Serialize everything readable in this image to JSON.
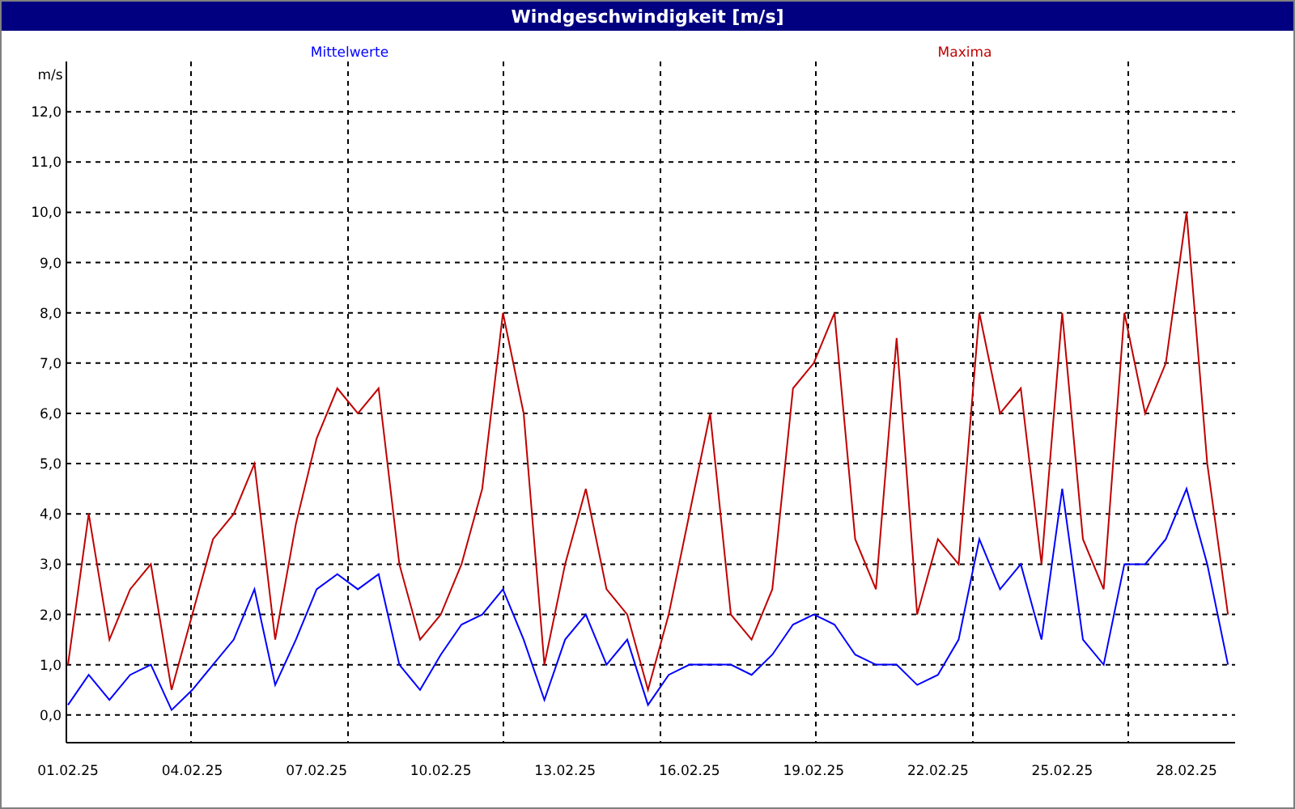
{
  "window": {
    "title": "Windgeschwindigkeit [m/s]"
  },
  "chart": {
    "chart_data": {
      "type": "line",
      "ylabel": "m/s",
      "categories": [
        "01.02.25",
        null,
        null,
        null,
        null,
        null,
        "04.02.25",
        null,
        null,
        null,
        null,
        null,
        "07.02.25",
        null,
        null,
        null,
        null,
        null,
        "10.02.25",
        null,
        null,
        null,
        null,
        null,
        "13.02.25",
        null,
        null,
        null,
        null,
        null,
        "16.02.25",
        null,
        null,
        null,
        null,
        null,
        "19.02.25",
        null,
        null,
        null,
        null,
        null,
        "22.02.25",
        null,
        null,
        null,
        null,
        null,
        "25.02.25",
        null,
        null,
        null,
        null,
        null,
        "28.02.25",
        null,
        null
      ],
      "series": [
        {
          "name": "Mittelwerte",
          "color": "#0000ff",
          "values": [
            0.2,
            0.8,
            0.3,
            0.8,
            1.0,
            0.1,
            0.5,
            1.0,
            1.5,
            2.5,
            0.6,
            1.5,
            2.5,
            2.8,
            2.5,
            2.8,
            1.0,
            0.5,
            1.2,
            1.8,
            2.0,
            2.5,
            1.5,
            0.3,
            1.5,
            2.0,
            1.0,
            1.5,
            0.2,
            0.8,
            1.0,
            1.0,
            1.0,
            0.8,
            1.2,
            1.8,
            2.0,
            1.8,
            1.2,
            1.0,
            1.0,
            0.6,
            0.8,
            1.5,
            3.5,
            2.5,
            3.0,
            1.5,
            4.5,
            1.5,
            1.0,
            3.0,
            3.0,
            3.5,
            4.5,
            3.0,
            1.0
          ]
        },
        {
          "name": "Maxima",
          "color": "#c00000",
          "values": [
            1.0,
            4.0,
            1.5,
            2.5,
            3.0,
            0.5,
            2.0,
            3.5,
            4.0,
            5.0,
            1.5,
            3.8,
            5.5,
            6.5,
            6.0,
            6.5,
            3.0,
            1.5,
            2.0,
            3.0,
            4.5,
            8.0,
            6.0,
            1.0,
            3.0,
            4.5,
            2.5,
            2.0,
            0.5,
            2.0,
            4.0,
            6.0,
            2.0,
            1.5,
            2.5,
            6.5,
            7.0,
            8.0,
            3.5,
            2.5,
            7.5,
            2.0,
            3.5,
            3.0,
            8.0,
            6.0,
            6.5,
            3.0,
            8.0,
            3.5,
            2.5,
            8.0,
            6.0,
            7.0,
            10.0,
            5.0,
            2.0
          ]
        }
      ],
      "ylim": [
        -0.55,
        13
      ],
      "grid": true,
      "yticks": [
        {
          "value": 0,
          "label": "0,0"
        },
        {
          "value": 1,
          "label": "1,0"
        },
        {
          "value": 2,
          "label": "2,0"
        },
        {
          "value": 3,
          "label": "3,0"
        },
        {
          "value": 4,
          "label": "4,0"
        },
        {
          "value": 5,
          "label": "5,0"
        },
        {
          "value": 6,
          "label": "6,0"
        },
        {
          "value": 7,
          "label": "7,0"
        },
        {
          "value": 8,
          "label": "8,0"
        },
        {
          "value": 9,
          "label": "9,0"
        },
        {
          "value": 10,
          "label": "10,0"
        },
        {
          "value": 11,
          "label": "11,0"
        },
        {
          "value": 12,
          "label": "12,0"
        }
      ]
    }
  }
}
